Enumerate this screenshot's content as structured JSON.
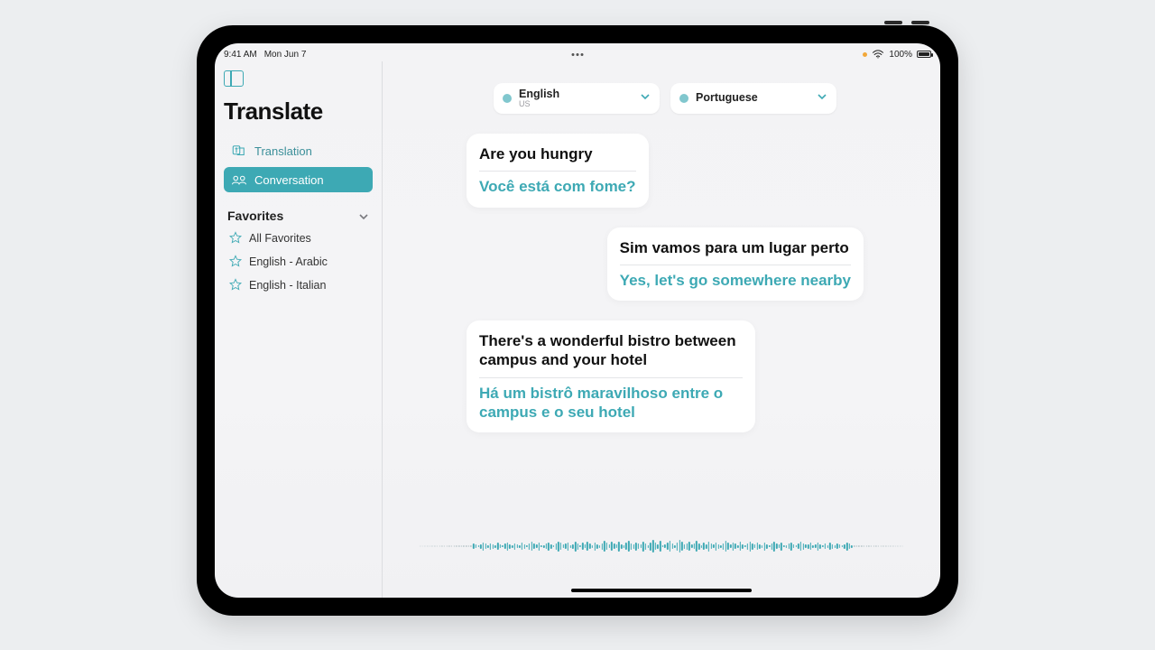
{
  "status": {
    "time": "9:41 AM",
    "date": "Mon Jun 7",
    "wifi": "100%",
    "battery": "100%"
  },
  "sidebar": {
    "title": "Translate",
    "nav": [
      {
        "id": "translation",
        "label": "Translation"
      },
      {
        "id": "conversation",
        "label": "Conversation"
      }
    ],
    "favorites_header": "Favorites",
    "favorites": [
      {
        "label": "All Favorites"
      },
      {
        "label": "English - Arabic"
      },
      {
        "label": "English - Italian"
      }
    ]
  },
  "languages": {
    "left": {
      "name": "English",
      "sub": "US"
    },
    "right": {
      "name": "Portuguese",
      "sub": ""
    }
  },
  "conversation": [
    {
      "align": "left",
      "src": "Are you hungry",
      "tgt": "Você está com fome?"
    },
    {
      "align": "right",
      "src": "Sim vamos para um lugar perto",
      "tgt": "Yes, let's go somewhere nearby"
    },
    {
      "align": "left",
      "src": "There's a wonderful bistro between campus and your hotel",
      "tgt": "Há um bistrô maravilhoso entre o campus e o seu hotel"
    }
  ]
}
